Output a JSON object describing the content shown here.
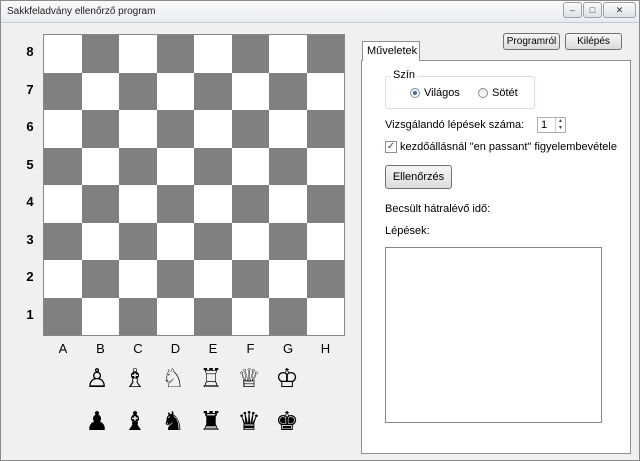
{
  "window": {
    "title": "Sakkfeladvány ellenőrző program",
    "minimize_glyph": "–",
    "maximize_glyph": "□",
    "close_glyph": "✕"
  },
  "header_buttons": {
    "about": "Programról",
    "exit": "Kilépés"
  },
  "board": {
    "ranks": [
      "8",
      "7",
      "6",
      "5",
      "4",
      "3",
      "2",
      "1"
    ],
    "files": [
      "A",
      "B",
      "C",
      "D",
      "E",
      "F",
      "G",
      "H"
    ],
    "light_color": "#ffffff",
    "dark_color": "#808080"
  },
  "palette": {
    "white": [
      {
        "name": "white-pawn-icon",
        "glyph": "♙"
      },
      {
        "name": "white-bishop-icon",
        "glyph": "♗"
      },
      {
        "name": "white-knight-icon",
        "glyph": "♘"
      },
      {
        "name": "white-rook-icon",
        "glyph": "♖"
      },
      {
        "name": "white-queen-icon",
        "glyph": "♕"
      },
      {
        "name": "white-king-icon",
        "glyph": "♔"
      }
    ],
    "black": [
      {
        "name": "black-pawn-icon",
        "glyph": "♟"
      },
      {
        "name": "black-bishop-icon",
        "glyph": "♝"
      },
      {
        "name": "black-knight-icon",
        "glyph": "♞"
      },
      {
        "name": "black-rook-icon",
        "glyph": "♜"
      },
      {
        "name": "black-queen-icon",
        "glyph": "♛"
      },
      {
        "name": "black-king-icon",
        "glyph": "♚"
      }
    ]
  },
  "operations": {
    "tab_label": "Műveletek",
    "color_group": {
      "legend": "Szín",
      "options": [
        {
          "label": "Világos",
          "selected": true
        },
        {
          "label": "Sötét",
          "selected": false
        }
      ]
    },
    "moves_label": "Vizsgálandó lépések száma:",
    "moves_value": "1",
    "spin_up": "▲",
    "spin_down": "▼",
    "en_passant_label": "kezdőállásnál \"en passant\" figyelembevétele",
    "en_passant_checked": true,
    "check_mark": "✓",
    "check_button": "Ellenőrzés",
    "estimated_time_label": "Becsült hátralévő idő:",
    "steps_label": "Lépések:",
    "steps": []
  }
}
